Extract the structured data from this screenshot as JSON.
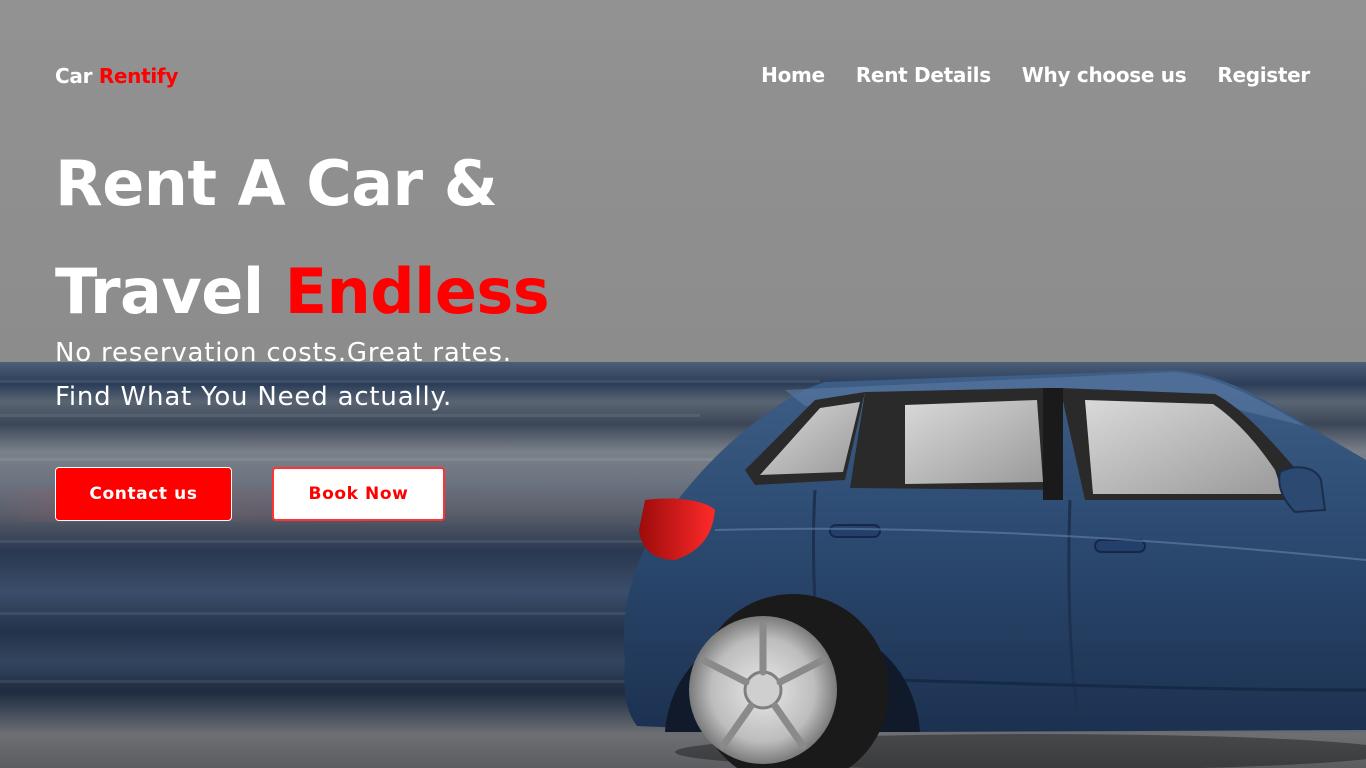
{
  "logo": {
    "prefix": "Car",
    "accent": "Rentify"
  },
  "nav": {
    "items": [
      {
        "label": "Home"
      },
      {
        "label": "Rent Details"
      },
      {
        "label": "Why choose us"
      },
      {
        "label": "Register"
      }
    ]
  },
  "hero": {
    "line1": "Rent A Car &",
    "line2_prefix": "Travel",
    "line2_accent": "Endless",
    "sub_line1": "No reservation costs.Great rates.",
    "sub_line2": "Find What You Need actually.",
    "contact_label": "Contact us",
    "book_label": "Book Now"
  },
  "colors": {
    "accent": "#ff0000",
    "text": "#ffffff",
    "car_body": "#2e4a6e"
  },
  "icons": [
    "car-image"
  ]
}
